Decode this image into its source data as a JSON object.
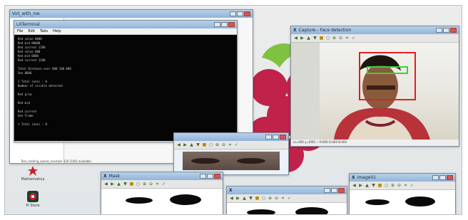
{
  "desktop": {
    "icons": [
      {
        "label": "Mathematica",
        "icon": "mathematica-icon"
      },
      {
        "label": "Pi Store",
        "icon": "pi-store-icon"
      }
    ],
    "status_line": "Text_reading_speed_example 120 (100) available"
  },
  "explorer_window": {
    "title": "Virt_with_me"
  },
  "terminal": {
    "title": "LXTerminal",
    "menu": [
      "File",
      "Edit",
      "Tabs",
      "Help"
    ],
    "lines": [
      "Red value 0000",
      "Red mid 00000",
      "Red current 1200",
      "Red value 000",
      "Red mid 0000",
      "Red current 1200",
      "",
      "Total Distance over 000 100 000",
      "See 0000",
      "",
      "1 Total (one) : 0",
      "Number of visible detected",
      "",
      "Red prim",
      "",
      "Red mid",
      "",
      "Red current",
      "See Frame",
      "",
      "1 Total (one) : 0"
    ]
  },
  "capture_window": {
    "title": "Capture - Face detection",
    "status": "(x=000 y=000) ~ R:000 G:000 B:000",
    "colors": {
      "face_box": "#e02020",
      "eye_box": "#3ad13a"
    }
  },
  "eyes_window": {
    "title": ""
  },
  "mask_window": {
    "title": "Mask"
  },
  "mid_window": {
    "title": ""
  },
  "image_window": {
    "title": "image01"
  }
}
